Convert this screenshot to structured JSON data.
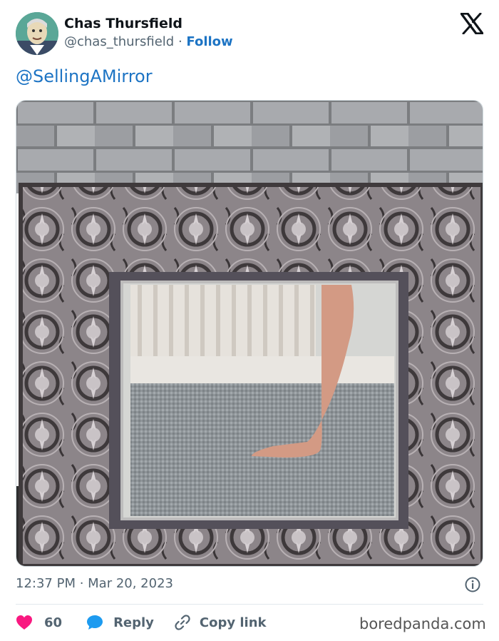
{
  "author": {
    "display_name": "Chas Thursfield",
    "handle": "@chas_thursfield",
    "separator": " · ",
    "follow_label": "Follow"
  },
  "tweet": {
    "text": "@SellingAMirror",
    "timestamp": "12:37 PM · Mar 20, 2023"
  },
  "actions": {
    "like_count": "60",
    "reply_label": "Reply",
    "copy_label": "Copy link"
  },
  "colors": {
    "link": "#1d74c4",
    "like": "#f91880",
    "reply": "#1d9bf0",
    "muted": "#536471"
  },
  "icons": [
    "x-logo-icon",
    "info-icon",
    "heart-icon",
    "reply-bubble-icon",
    "link-icon"
  ],
  "watermark": "boredpanda.com"
}
